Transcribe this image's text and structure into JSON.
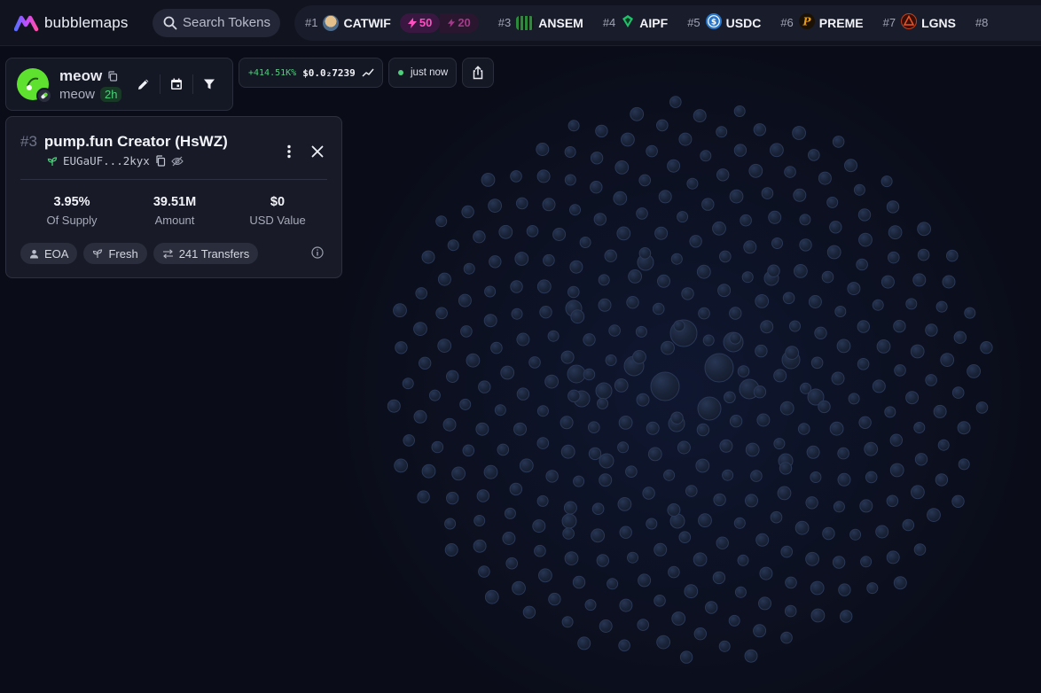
{
  "app": {
    "name": "bubblemaps"
  },
  "search": {
    "placeholder": "Search Tokens"
  },
  "trending": [
    {
      "rank": "#1",
      "symbol": "CATWIF",
      "boost": "50",
      "icon": "catwif-icon",
      "color": "#caa26b"
    },
    {
      "rank": "",
      "symbol": "",
      "boost": "20",
      "icon": "",
      "color": ""
    },
    {
      "rank": "#3",
      "symbol": "ANSEM",
      "icon": "ansem-icon",
      "color": "#2c8a3c"
    },
    {
      "rank": "#4",
      "symbol": "AIPF",
      "icon": "aipf-icon",
      "color": "#21c06b"
    },
    {
      "rank": "#5",
      "symbol": "USDC",
      "icon": "usdc-icon",
      "color": "#2775ca"
    },
    {
      "rank": "#6",
      "symbol": "PREME",
      "icon": "preme-icon",
      "color": "#e59a1e"
    },
    {
      "rank": "#7",
      "symbol": "LGNS",
      "icon": "lgns-icon",
      "color": "#c2411c"
    },
    {
      "rank": "#8",
      "symbol": "",
      "icon": "",
      "color": ""
    }
  ],
  "token": {
    "name": "meow",
    "ticker": "meow",
    "age": "2h",
    "price_change": "+414.51K%",
    "price": "$0.0₂7239",
    "update_status": "just now",
    "avatar_color": "#5fe12f"
  },
  "wallet": {
    "rank": "#3",
    "title": "pump.fun Creator (HsWZ)",
    "address": "EUGaUF...2kyx",
    "stats": [
      {
        "value": "3.95%",
        "label": "Of Supply"
      },
      {
        "value": "39.51M",
        "label": "Amount"
      },
      {
        "value": "$0",
        "label": "USD Value"
      }
    ],
    "tags": [
      {
        "label": "EOA",
        "icon": "user-icon"
      },
      {
        "label": "Fresh",
        "icon": "sprout-icon"
      },
      {
        "label": "241 Transfers",
        "icon": "transfer-icon"
      }
    ]
  },
  "colors": {
    "background": "#0a0c17",
    "bubble_fill": "#1a2236",
    "bubble_stroke": "#2a3857",
    "accent_pink": "#ff4fc1",
    "accent_green": "#4fd07c"
  }
}
